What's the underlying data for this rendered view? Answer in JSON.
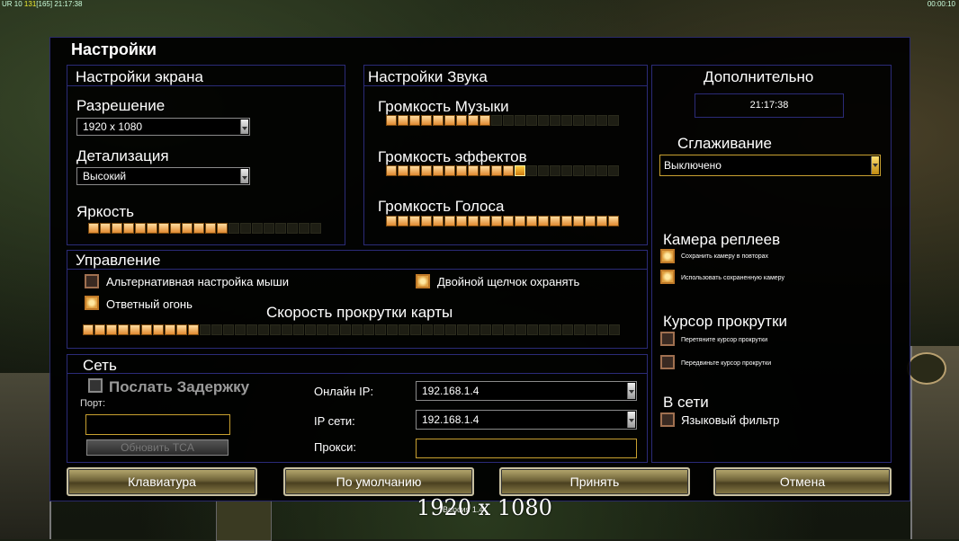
{
  "hud": {
    "left_ur": "UR 10",
    "left_money": "131",
    "left_bracket": "[165]",
    "left_time": "21:17:38",
    "right_time": "00:00:10"
  },
  "title": "Настройки",
  "screen": {
    "header": "Настройки экрана",
    "resolution_label": "Разрешение",
    "resolution_value": "1920 x 1080",
    "detail_label": "Детализация",
    "detail_value": "Высокий",
    "brightness_label": "Яркость",
    "brightness_level": 12,
    "brightness_total": 20
  },
  "sound": {
    "header": "Настройки Звука",
    "music_label": "Громкость Музыки",
    "music_level": 9,
    "music_total": 20,
    "effects_label": "Громкость эффектов",
    "effects_level": 11,
    "effects_total": 20,
    "voice_label": "Громкость Голоса",
    "voice_level": 20,
    "voice_total": 20
  },
  "extra": {
    "header": "Дополнительно",
    "clock": "21:17:38",
    "antialias_label": "Сглаживание",
    "antialias_value": "Выключено",
    "replay_camera_label": "Камера реплеев",
    "save_camera_label": "Сохранить камеру в повторах",
    "use_saved_camera_label": "Использовать сохраненную камеру",
    "scroll_cursor_label": "Курсор прокрутки",
    "drag_cursor_label": "Перетяните курсор прокрутки",
    "move_cursor_label": "Передвиньте курсор прокрутки",
    "online_label": "В сети",
    "language_filter_label": "Языковый фильтр"
  },
  "control": {
    "header": "Управление",
    "alt_mouse_label": "Альтернативная настройка мыши",
    "double_click_label": "Двойной щелчок охранять",
    "return_fire_label": "Ответный огонь",
    "scroll_speed_label": "Скорость прокрутки карты",
    "scroll_level": 10,
    "scroll_total": 46
  },
  "network": {
    "header": "Сеть",
    "send_delay_label": "Послать Задержку",
    "port_label": "Порт:",
    "update_button": "Обновить TCA",
    "online_ip_label": "Онлайн IP:",
    "online_ip_value": "192.168.1.4",
    "lan_ip_label": "IP сети:",
    "lan_ip_value": "192.168.1.4",
    "proxy_label": "Прокси:"
  },
  "buttons": {
    "keyboard": "Клавиатура",
    "defaults": "По умолчанию",
    "accept": "Принять",
    "cancel": "Отмена"
  },
  "caption": "1920 x 1080",
  "version": "Версия 1.4",
  "colors": {
    "segment_on": "#f0b070",
    "segment_knob": "#ffcc40",
    "border_blue": "#2b2b78",
    "accent_gold": "#c8a030"
  }
}
